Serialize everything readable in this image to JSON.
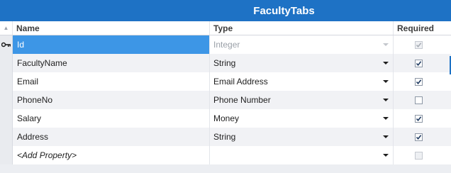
{
  "window": {
    "title": "FacultyTabs"
  },
  "columns": {
    "name": "Name",
    "type": "Type",
    "required": "Required"
  },
  "rows": [
    {
      "name": "Id",
      "type": "Integer",
      "required": true,
      "key": true,
      "selected": true,
      "disabled": true
    },
    {
      "name": "FacultyName",
      "type": "String",
      "required": true
    },
    {
      "name": "Email",
      "type": "Email Address",
      "required": true
    },
    {
      "name": "PhoneNo",
      "type": "Phone Number",
      "required": false
    },
    {
      "name": "Salary",
      "type": "Money",
      "required": true
    },
    {
      "name": "Address",
      "type": "String",
      "required": true
    }
  ],
  "add_row": {
    "label": "<Add Property>",
    "type": ""
  },
  "colors": {
    "titlebar": "#1e72c5",
    "selection": "#3d96e6"
  }
}
